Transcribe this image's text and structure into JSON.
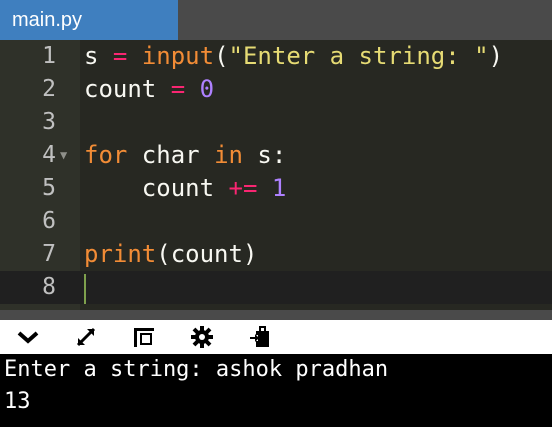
{
  "tab": {
    "filename": "main.py"
  },
  "editor": {
    "line_numbers": [
      "1",
      "2",
      "3",
      "4",
      "5",
      "6",
      "7",
      "8"
    ],
    "line1": {
      "var": "s",
      "assign": " = ",
      "func": "input",
      "open": "(",
      "arg": "\"Enter a string: \"",
      "close": ")"
    },
    "line2": {
      "var": "count",
      "assign": " = ",
      "value": "0"
    },
    "line4": {
      "kw_for": "for",
      "mid": " char ",
      "kw_in": "in",
      "rest": " s:"
    },
    "line5": {
      "indent": "    ",
      "var": "count",
      "op": " += ",
      "value": "1"
    },
    "line7": {
      "func": "print",
      "args": "(count)"
    }
  },
  "toolbar": {
    "icons": [
      "collapse-chevron-icon",
      "expand-arrows-icon",
      "layout-panel-icon",
      "settings-gear-icon",
      "share-run-icon"
    ]
  },
  "console": {
    "lines": [
      "Enter a string: ashok pradhan",
      "13"
    ]
  }
}
